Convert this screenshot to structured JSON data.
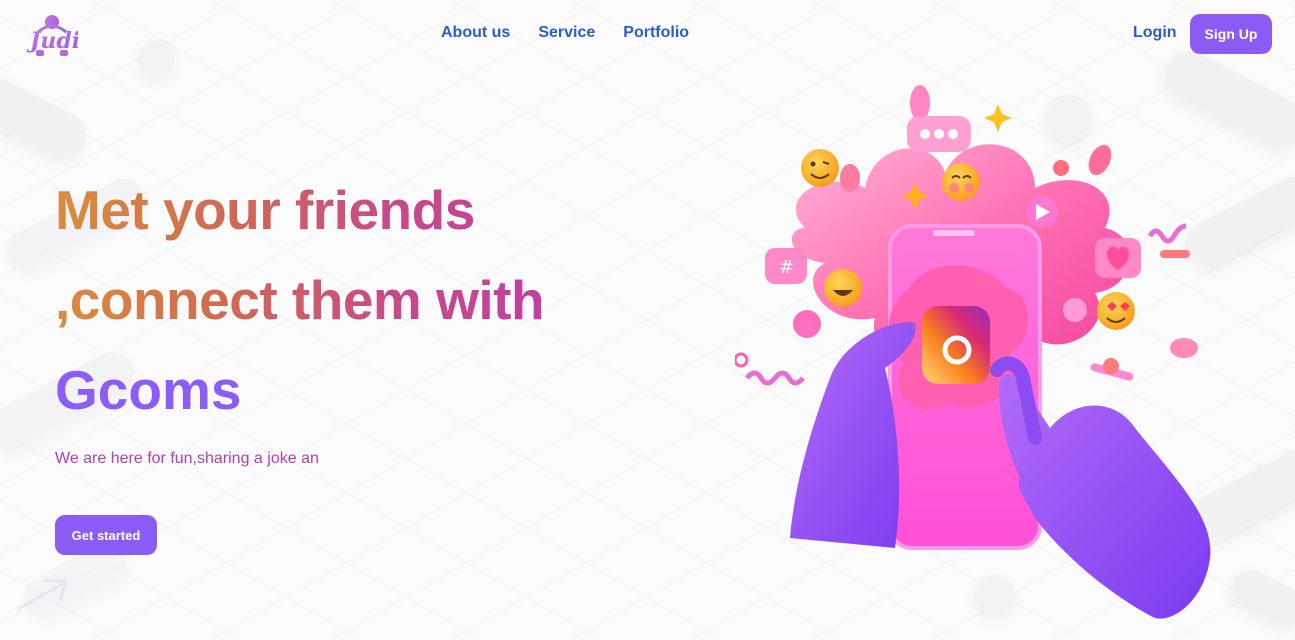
{
  "brand": {
    "name": "Judi",
    "logo_icon": "brand-logo-icon"
  },
  "nav": {
    "items": [
      {
        "label": "About us"
      },
      {
        "label": "Service"
      },
      {
        "label": "Portfolio"
      }
    ]
  },
  "auth": {
    "login_label": "Login",
    "signup_label": "Sign Up"
  },
  "hero": {
    "line1": "Met your friends",
    "line2": ",connect them with",
    "line3": "Gcoms",
    "tagline": "We are here for fun,sharing a joke an",
    "cta_label": "Get started"
  },
  "colors": {
    "accent": "#8a5cf5",
    "nav_link": "#2b5cc9",
    "tagline": "#b03fb2",
    "headline_gradient_start": "#d98d3e",
    "headline_gradient_end": "#c23fa0"
  },
  "illustration": {
    "icon": "phone-with-hands-social-illustration"
  }
}
